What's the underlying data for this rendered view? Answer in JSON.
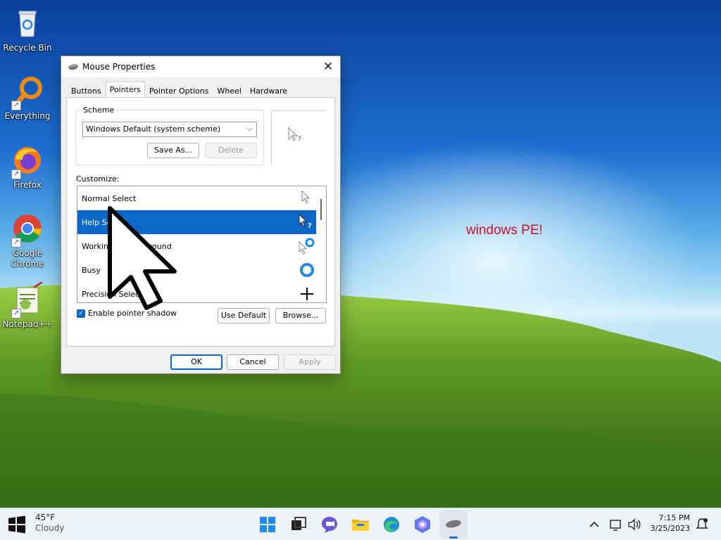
{
  "desktop": {
    "text": "windows PE!",
    "icons": [
      {
        "label": "Recycle Bin",
        "icon": "recycle-bin-icon"
      },
      {
        "label": "Everything",
        "icon": "search-magnifier-icon"
      },
      {
        "label": "Firefox",
        "icon": "firefox-icon"
      },
      {
        "label": "Google Chrome",
        "icon": "chrome-icon"
      },
      {
        "label": "Notepad++",
        "icon": "notepad-plus-plus-icon"
      }
    ]
  },
  "window": {
    "title": "Mouse Properties",
    "close": "✕",
    "tabs": [
      "Buttons",
      "Pointers",
      "Pointer Options",
      "Wheel",
      "Hardware"
    ],
    "active_tab": "Pointers",
    "scheme_label": "Scheme",
    "scheme_value": "Windows Default (system scheme)",
    "save_as": "Save As...",
    "delete": "Delete",
    "customize_label": "Customize:",
    "pointers": [
      {
        "label": "Normal Select",
        "selected": false
      },
      {
        "label": "Help Select",
        "selected": true
      },
      {
        "label": "Working In Background",
        "selected": false
      },
      {
        "label": "Busy",
        "selected": false
      },
      {
        "label": "Precision Select",
        "selected": false
      }
    ],
    "enable_shadow": "Enable pointer shadow",
    "use_default": "Use Default",
    "browse": "Browse...",
    "ok": "OK",
    "cancel": "Cancel",
    "apply": "Apply"
  },
  "taskbar": {
    "temperature": "45°F",
    "condition": "Cloudy",
    "time": "7:15 PM",
    "date": "3/25/2023"
  },
  "colors": {
    "accent": "#0b68c9",
    "desktop_text": "#c8102e"
  }
}
